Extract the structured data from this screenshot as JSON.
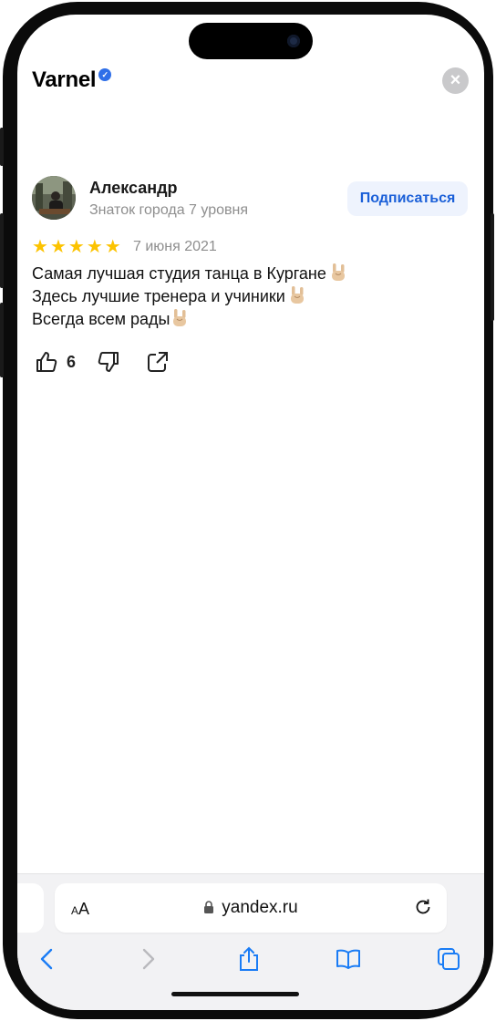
{
  "header": {
    "title": "Varnel",
    "close_label": "×"
  },
  "review": {
    "author": "Александр",
    "level": "Знаток города 7 уровня",
    "subscribe_label": "Подписаться",
    "rating": 5,
    "date": "7 июня 2021",
    "lines": [
      "Самая лучшая студия танца в Кургане",
      "Здесь лучшие тренера и учиники",
      "Всегда всем рады"
    ],
    "likes": "6"
  },
  "browser": {
    "aa_label_small": "A",
    "aa_label_large": "A",
    "url": "yandex.ru"
  },
  "icons": {
    "verified": "verified-badge-icon",
    "like": "thumbs-up-icon",
    "dislike": "thumbs-down-icon",
    "share": "share-external-icon",
    "emoji": "sign-of-horns-emoji",
    "lock": "lock-icon",
    "reload": "reload-icon",
    "back": "chevron-left-icon",
    "forward": "chevron-right-icon",
    "share_browser": "share-icon",
    "bookmarks": "book-icon",
    "tabs": "tabs-icon"
  },
  "colors": {
    "star": "#fcc300",
    "accent": "#1a5fd8",
    "verified": "#2f6fe8",
    "browser_blue": "#1a7cf5"
  }
}
